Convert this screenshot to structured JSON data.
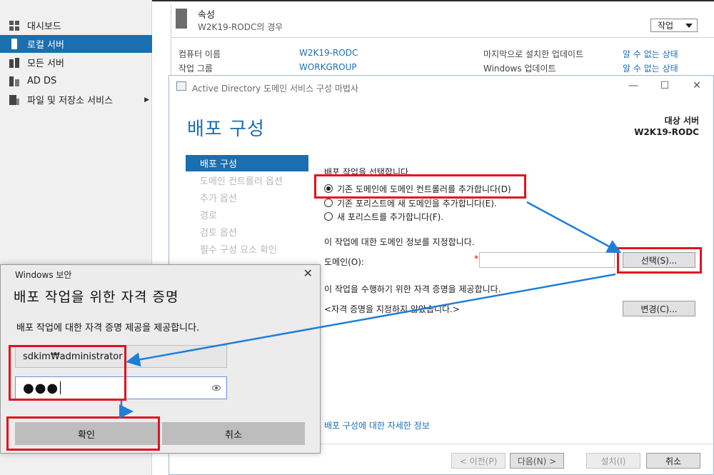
{
  "sidebar": {
    "items": [
      {
        "label": "대시보드",
        "icon": "dashboard-icon"
      },
      {
        "label": "로컬 서버",
        "icon": "server-icon"
      },
      {
        "label": "모든 서버",
        "icon": "servers-icon"
      },
      {
        "label": "AD DS",
        "icon": "ad-ds-icon"
      },
      {
        "label": "파일 및 저장소 서비스",
        "icon": "file-storage-icon",
        "arrow": "▶"
      }
    ],
    "active_index": 1
  },
  "properties": {
    "title": "속성",
    "subtitle": "W2K19-RODC의 경우",
    "tasks_label": "작업",
    "computer_name_label": "컴퓨터 이름",
    "computer_name_value": "W2K19-RODC",
    "workgroup_label": "작업 그룹",
    "workgroup_value": "WORKGROUP",
    "last_update_label": "마지막으로 설치한 업데이트",
    "last_update_value": "알 수 없는 상태",
    "windows_update_label": "Windows 업데이트",
    "windows_update_value": "알 수 없는 상태"
  },
  "wizard": {
    "window_title": "Active Directory 도메인 서비스 구성 마법사",
    "heading": "배포 구성",
    "target_label": "대상 서버",
    "target_value": "W2K19-RODC",
    "steps": [
      "배포 구성",
      "도메인 컨트롤러 옵션",
      "추가 옵션",
      "경로",
      "검토 옵션",
      "필수 구성 요소 확인"
    ],
    "active_step": 0,
    "operation_label": "배포 작업을 선택합니다.",
    "options": [
      {
        "label": "기존 도메인에 도메인 컨트롤러를 추가합니다(D)",
        "selected": true
      },
      {
        "label": "기존 포리스트에 새 도메인을 추가합니다(E).",
        "selected": false
      },
      {
        "label": "새 포리스트를 추가합니다(F).",
        "selected": false
      }
    ],
    "domain_info_label": "이 작업에 대한 도메인 정보를 지정합니다.",
    "domain_label": "도메인(O):",
    "domain_required_mark": "*",
    "domain_value": "",
    "select_button": "선택(S)...",
    "credentials_label": "이 작업을 수행하기 위한 자격 증명을 제공합니다.",
    "credentials_value": "<자격 증명을 지정하지 않았습니다.>",
    "change_button": "변경(C)...",
    "more_info_link": "배포 구성에 대한 자세한 정보",
    "prev_button": "< 이전(P)",
    "next_button": "다음(N) >",
    "install_button": "설치(I)",
    "cancel_button": "취소"
  },
  "security_dialog": {
    "title": "Windows 보안",
    "close": "✕",
    "heading": "배포 작업을 위한 자격 증명",
    "description": "배포 작업에 대한 자격 증명 제공을 제공합니다.",
    "username_value": "sdkim₩administrator",
    "password_mask": "●●●",
    "ok_button": "확인",
    "cancel_button": "취소"
  },
  "colors": {
    "accent": "#1a6fb3",
    "annotation_red": "#e0141e",
    "annotation_arrow": "#1e7fd8"
  }
}
